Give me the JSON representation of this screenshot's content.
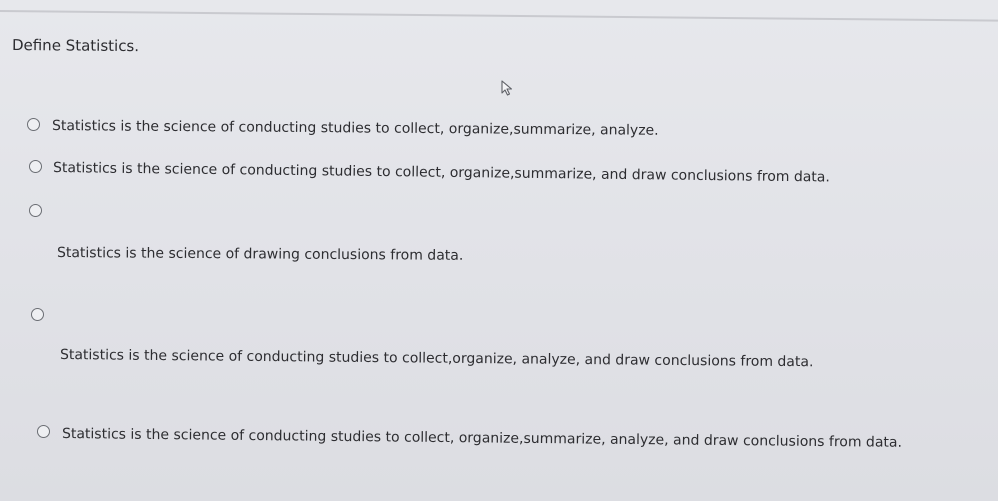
{
  "question": {
    "text": "Define Statistics."
  },
  "options": [
    {
      "label": "Statistics is the science of conducting studies to collect, organize,summarize, analyze."
    },
    {
      "label": "Statistics is the science of conducting studies to collect, organize,summarize, and draw conclusions from data."
    },
    {
      "label": "Statistics is the science of drawing conclusions from data."
    },
    {
      "label": "Statistics is the science of conducting studies to collect,organize, analyze, and draw conclusions from data."
    },
    {
      "label": "Statistics is the science of conducting studies to collect, organize,summarize, analyze, and draw conclusions from data."
    }
  ],
  "icons": {
    "cursor": "mouse-pointer-icon",
    "radio": "radio-button-icon"
  }
}
